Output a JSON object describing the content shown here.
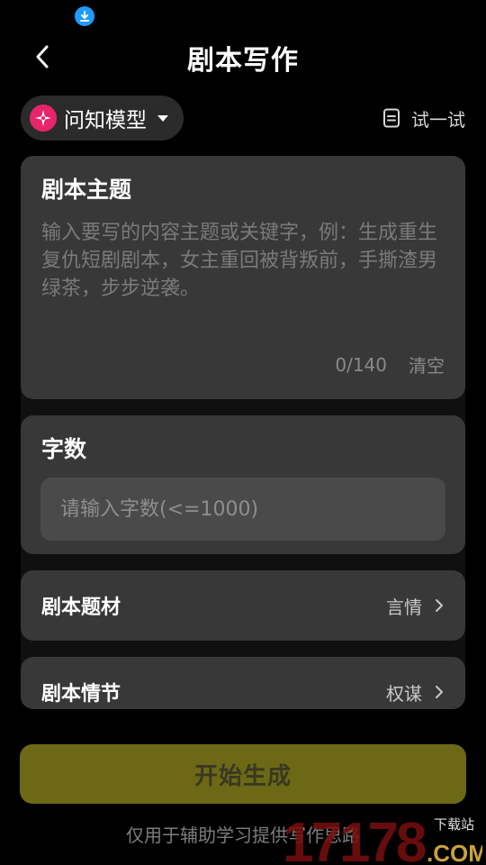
{
  "header": {
    "title": "剧本写作",
    "back_icon": "chevron-left-icon",
    "download_icon": "download-icon"
  },
  "model_selector": {
    "name": "问知模型",
    "logo_icon": "sparkle-icon",
    "caret_icon": "caret-down-icon",
    "logo_color": "#e8246b"
  },
  "try_button": {
    "label": "试一试",
    "icon": "document-icon"
  },
  "theme_card": {
    "title": "剧本主题",
    "placeholder": "输入要写的内容主题或关键字，例：生成重生复仇短剧剧本，女主重回被背叛前，手撕渣男绿茶，步步逆袭。",
    "value": "",
    "counter": "0/140",
    "clear_label": "清空"
  },
  "word_count_card": {
    "title": "字数",
    "placeholder": "请输入字数(<=1000)",
    "value": ""
  },
  "genre_row": {
    "label": "剧本题材",
    "value": "言情",
    "icon": "chevron-right-icon"
  },
  "plot_row": {
    "label": "剧本情节",
    "value": "权谋",
    "icon": "chevron-right-icon"
  },
  "generate_button": {
    "label": "开始生成",
    "color": "#6c6816"
  },
  "disclaimer": "仅用于辅助学习提供写作思路",
  "watermark": {
    "number": "17178",
    "site": "下载站",
    "suffix": ".COM"
  },
  "colors": {
    "background": "#000000",
    "card": "#383838",
    "input": "#4a4a4a",
    "accent": "#6c6816"
  }
}
